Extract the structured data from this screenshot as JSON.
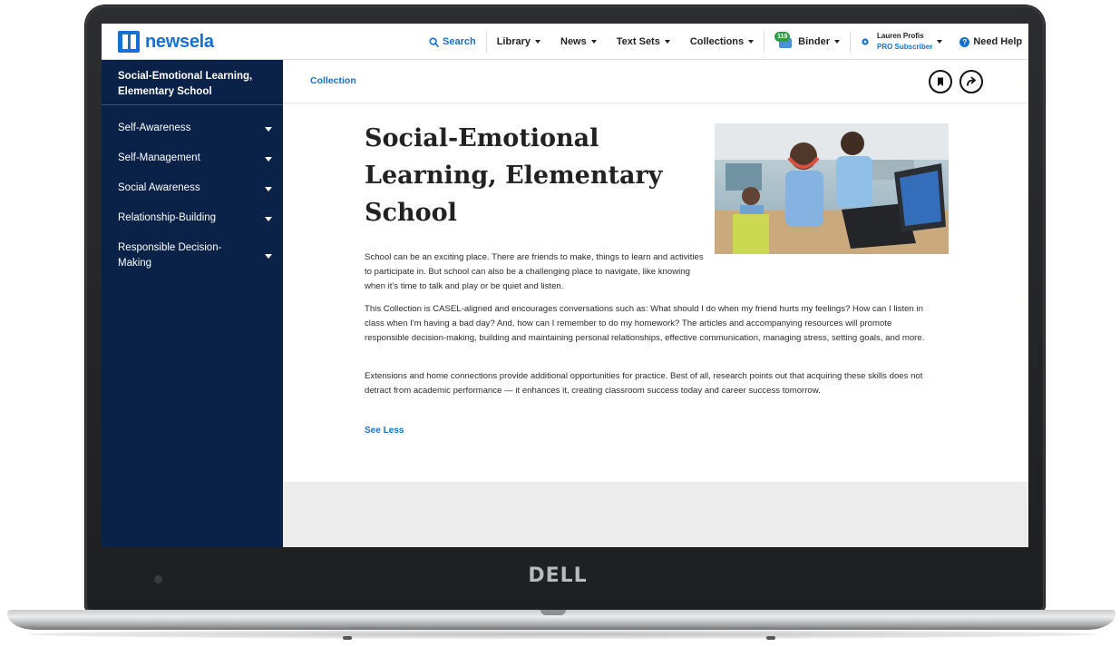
{
  "device": {
    "brand": "DELL"
  },
  "header": {
    "logo": "newsela",
    "search": "Search",
    "library": "Library",
    "news": "News",
    "text_sets": "Text Sets",
    "collections": "Collections",
    "binder_count": "119",
    "binder": "Binder",
    "user_name": "Lauren Profis",
    "user_plan": "PRO Subscriber",
    "help": "Need Help"
  },
  "sidebar": {
    "title": "Social-Emotional Learning, Elementary School",
    "items": [
      {
        "label": "Self-Awareness"
      },
      {
        "label": "Self-Management"
      },
      {
        "label": "Social Awareness"
      },
      {
        "label": "Relationship-Building"
      },
      {
        "label": "Responsible Decision-Making"
      }
    ]
  },
  "main": {
    "breadcrumb": "Collection",
    "title": "Social-Emotional Learning, Elementary School",
    "paragraphs": [
      "School can be an exciting place. There are friends to make, things to learn and activities to participate in. But school can also be a challenging place to navigate, like knowing when it's time to talk and play or be quiet and listen.",
      "This Collection is CASEL-aligned and encourages conversations such as: What should I do when my friend hurts my feelings? How can I listen in class when I'm having a bad day? And, how can I remember to do my homework? The articles and accompanying resources will promote responsible decision-making, building and maintaining personal relationships, effective communication, managing stress, setting goals, and more.",
      "Extensions and home connections provide additional opportunities for practice. Best of all, research points out that acquiring these skills does not detract from academic performance — it enhances it, creating classroom success today and career success tomorrow."
    ],
    "see_less": "See Less"
  },
  "colors": {
    "brand_blue": "#1670d4",
    "sidebar_navy": "#0a2248"
  }
}
